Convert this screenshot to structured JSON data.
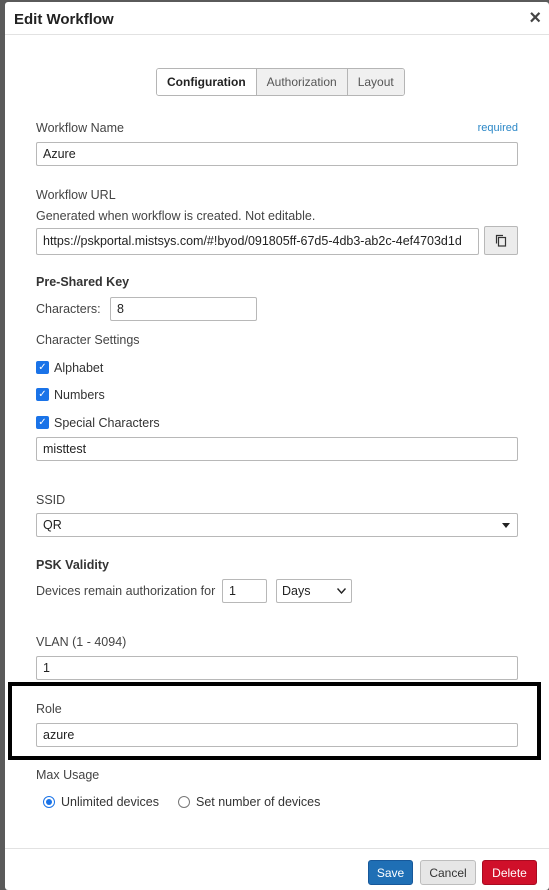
{
  "dialog": {
    "title": "Edit Workflow",
    "close_glyph": "×"
  },
  "tabs": [
    {
      "label": "Configuration"
    },
    {
      "label": "Authorization"
    },
    {
      "label": "Layout"
    }
  ],
  "workflow_name": {
    "label": "Workflow Name",
    "required": "required",
    "value": "Azure"
  },
  "workflow_url": {
    "label": "Workflow URL",
    "help": "Generated when workflow is created. Not editable.",
    "value": "https://pskportal.mistsys.com/#!byod/091805ff-67d5-4db3-ab2c-4ef4703d1d",
    "copy_icon": "copy-icon"
  },
  "psk": {
    "heading": "Pre-Shared Key",
    "characters_label": "Characters:",
    "characters_value": "8",
    "settings_label": "Character Settings",
    "options": [
      {
        "label": "Alphabet",
        "checked": true
      },
      {
        "label": "Numbers",
        "checked": true
      },
      {
        "label": "Special Characters",
        "checked": true
      }
    ],
    "special_value": "misttest"
  },
  "ssid": {
    "label": "SSID",
    "value": "QR"
  },
  "validity": {
    "heading": "PSK Validity",
    "prefix": "Devices remain authorization for",
    "amount": "1",
    "unit": "Days"
  },
  "vlan": {
    "label": "VLAN (1 - 4094)",
    "value": "1"
  },
  "role": {
    "label": "Role",
    "value": "azure"
  },
  "max_usage": {
    "label": "Max Usage",
    "options": [
      {
        "label": "Unlimited devices",
        "selected": true
      },
      {
        "label": "Set number of devices",
        "selected": false
      }
    ]
  },
  "buttons": {
    "save": "Save",
    "cancel": "Cancel",
    "delete": "Delete"
  },
  "colors": {
    "primary": "#1f6fb5",
    "danger": "#d0102a",
    "checkbox": "#1a73e8",
    "link": "#2b87c7"
  }
}
